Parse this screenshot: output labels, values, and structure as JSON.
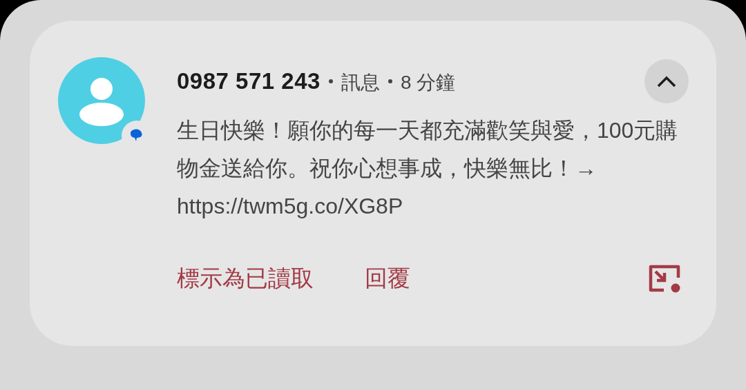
{
  "notification": {
    "sender": "0987 571 243",
    "app": "訊息",
    "time": "8 分鐘",
    "expanded": true,
    "message": "生日快樂！願你的每一天都充滿歡笑與愛，100元購物金送給你。祝你心想事成，快樂無比！→ https://twm5g.co/XG8P",
    "actions": [
      "標示為已讀取",
      "回覆"
    ]
  }
}
